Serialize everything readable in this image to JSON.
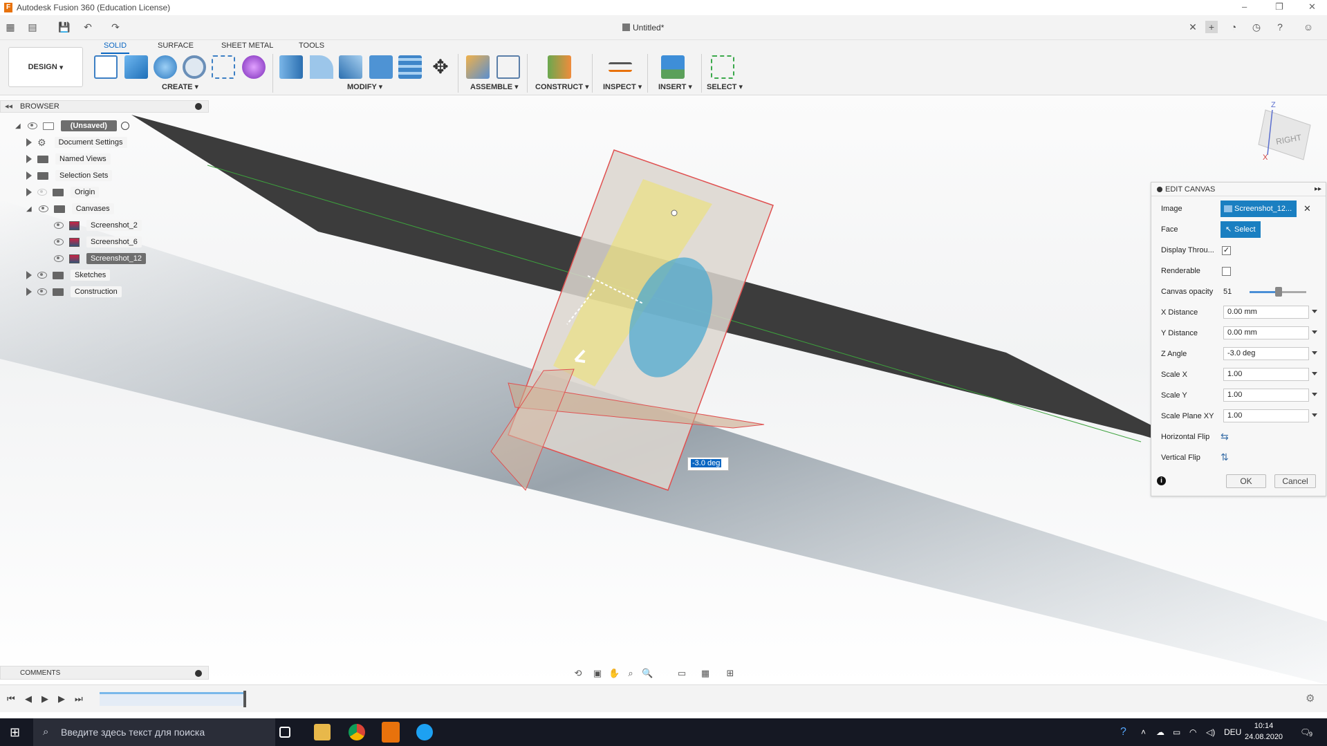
{
  "app": {
    "title": "Autodesk Fusion 360 (Education License)",
    "doc_tab": "Untitled*"
  },
  "ribbon": {
    "tabs": [
      "SOLID",
      "SURFACE",
      "SHEET METAL",
      "TOOLS"
    ],
    "workspace": "DESIGN",
    "groups": [
      "CREATE",
      "MODIFY",
      "ASSEMBLE",
      "CONSTRUCT",
      "INSPECT",
      "INSERT",
      "SELECT"
    ]
  },
  "browser": {
    "header": "BROWSER",
    "root": "(Unsaved)",
    "items": [
      "Document Settings",
      "Named Views",
      "Selection Sets",
      "Origin",
      "Canvases",
      "Screenshot_2",
      "Screenshot_6",
      "Screenshot_12",
      "Sketches",
      "Construction"
    ]
  },
  "edit_canvas": {
    "title": "EDIT CANVAS",
    "image_label": "Image",
    "image_value": "Screenshot_12...",
    "face_label": "Face",
    "face_value": "Select",
    "display_through_label": "Display Throu...",
    "renderable_label": "Renderable",
    "opacity_label": "Canvas opacity",
    "opacity_value": "51",
    "opacity_level": 0.51,
    "x_distance_label": "X Distance",
    "x_distance_value": "0.00 mm",
    "y_distance_label": "Y Distance",
    "y_distance_value": "0.00 mm",
    "z_angle_label": "Z Angle",
    "z_angle_value": "-3.0 deg",
    "scale_x_label": "Scale X",
    "scale_x_value": "1.00",
    "scale_y_label": "Scale Y",
    "scale_y_value": "1.00",
    "scale_plane_label": "Scale Plane XY",
    "scale_plane_value": "1.00",
    "h_flip_label": "Horizontal Flip",
    "v_flip_label": "Vertical Flip",
    "ok": "OK",
    "cancel": "Cancel"
  },
  "viewcube": {
    "face": "RIGHT",
    "axis_z": "Z",
    "axis_x": "X"
  },
  "rotation_input": "-3.0 deg",
  "comments": {
    "header": "COMMENTS"
  },
  "taskbar": {
    "search_placeholder": "Введите здесь текст для поиска",
    "lang": "DEU",
    "time": "10:14",
    "date": "24.08.2020",
    "notifications": "9"
  }
}
